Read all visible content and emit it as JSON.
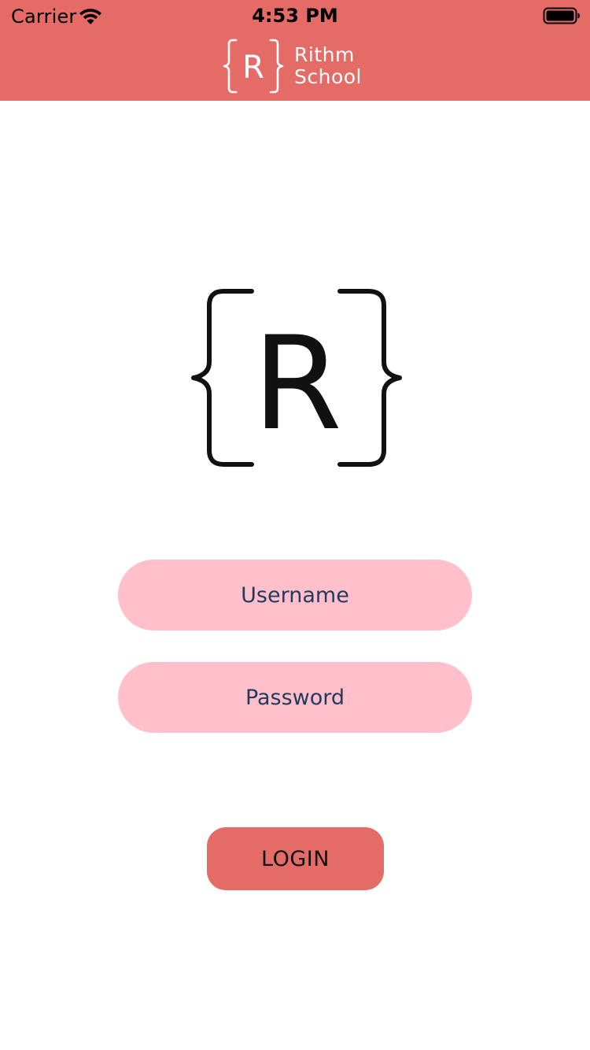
{
  "status_bar": {
    "carrier": "Carrier",
    "time": "4:53 PM"
  },
  "header": {
    "logo_letter": "R",
    "brand_line1": "Rithm",
    "brand_line2": "School",
    "background_color": "#E56B67"
  },
  "hero_logo": {
    "letter": "R"
  },
  "form": {
    "username_placeholder": "Username",
    "password_placeholder": "Password",
    "field_color": "#FFC0CB",
    "login_label": "LOGIN",
    "login_color": "#E56B67"
  }
}
